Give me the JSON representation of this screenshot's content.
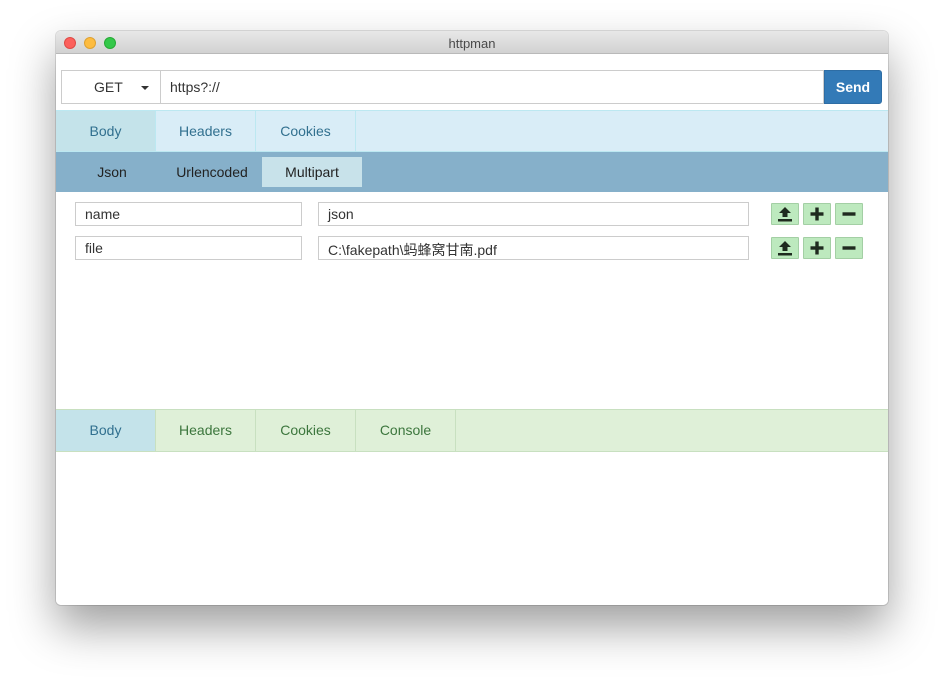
{
  "window": {
    "title": "httpman"
  },
  "request": {
    "method": "GET",
    "url": "https?://",
    "send_label": "Send"
  },
  "request_tabs": [
    {
      "label": "Body",
      "active": true
    },
    {
      "label": "Headers",
      "active": false
    },
    {
      "label": "Cookies",
      "active": false
    }
  ],
  "body_tabs": [
    {
      "label": "Json",
      "active": false
    },
    {
      "label": "Urlencoded",
      "active": false
    },
    {
      "label": "Multipart",
      "active": true
    }
  ],
  "multipart_rows": [
    {
      "key": "name",
      "value": "json"
    },
    {
      "key": "file",
      "value": "C:\\fakepath\\蚂蜂窝甘南.pdf"
    }
  ],
  "row_actions": [
    "upload-icon",
    "plus-icon",
    "minus-icon"
  ],
  "response_tabs": [
    {
      "label": "Body",
      "active": true
    },
    {
      "label": "Headers",
      "active": false
    },
    {
      "label": "Cookies",
      "active": false
    },
    {
      "label": "Console",
      "active": false
    }
  ],
  "colors": {
    "send_button": "#337ab7",
    "request_tabs_bg": "#d9edf7",
    "body_tabs_bg": "#86b0ca",
    "response_tabs_bg": "#dff0d8",
    "action_button": "#bde9be"
  }
}
